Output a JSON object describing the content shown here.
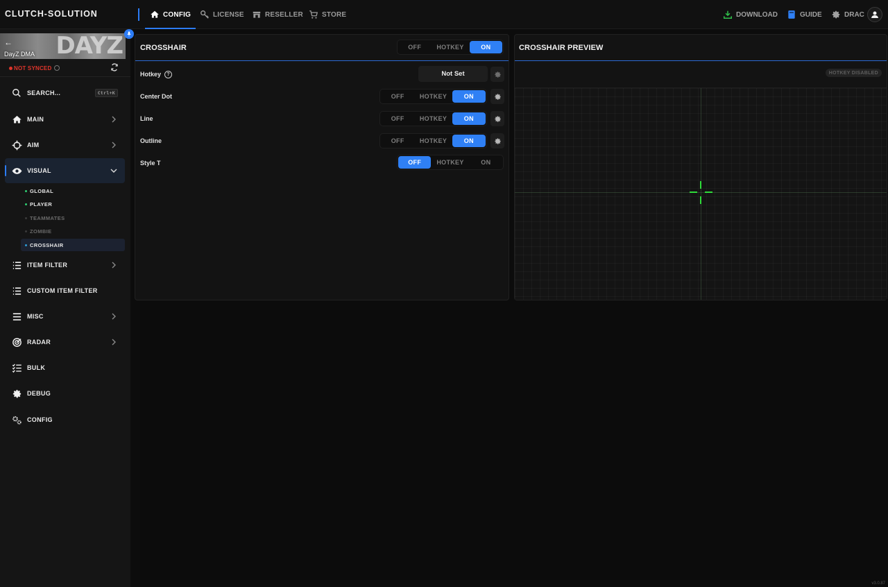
{
  "app": {
    "brand": "CLUTCH-SOLUTION",
    "accent_color": "#2f80f5",
    "version": "v3.0.87"
  },
  "top_nav": {
    "tabs": [
      {
        "label": "CONFIG",
        "icon": "home-icon",
        "active": true
      },
      {
        "label": "LICENSE",
        "icon": "key-icon",
        "active": false
      },
      {
        "label": "RESELLER",
        "icon": "store-icon",
        "active": false
      },
      {
        "label": "STORE",
        "icon": "cart-icon",
        "active": false
      }
    ],
    "right": {
      "download": "DOWNLOAD",
      "guide": "GUIDE",
      "user": "DRAC"
    }
  },
  "sidebar": {
    "game": {
      "name": "DayZ DMA",
      "logo_text": "DAYZ"
    },
    "sync_status": "NOT SYNCED",
    "search": {
      "label": "SEARCH...",
      "shortcut": "Ctrl+K"
    },
    "items": [
      {
        "label": "MAIN",
        "icon": "home-icon",
        "has_chevron": true
      },
      {
        "label": "AIM",
        "icon": "crosshair-icon",
        "has_chevron": true
      },
      {
        "label": "VISUAL",
        "icon": "eye-icon",
        "has_chevron": true,
        "expanded": true,
        "active": true
      },
      {
        "label": "ITEM FILTER",
        "icon": "list-icon",
        "has_chevron": true
      },
      {
        "label": "CUSTOM ITEM FILTER",
        "icon": "list-icon",
        "has_chevron": false
      },
      {
        "label": "MISC",
        "icon": "menu-icon",
        "has_chevron": true
      },
      {
        "label": "RADAR",
        "icon": "radar-icon",
        "has_chevron": true
      },
      {
        "label": "BULK",
        "icon": "checklist-icon",
        "has_chevron": false
      },
      {
        "label": "DEBUG",
        "icon": "gear-icon",
        "has_chevron": false
      },
      {
        "label": "CONFIG",
        "icon": "gears-icon",
        "has_chevron": false
      }
    ],
    "visual_sub": [
      {
        "label": "GLOBAL",
        "enabled": true,
        "active": false
      },
      {
        "label": "PLAYER",
        "enabled": true,
        "active": false
      },
      {
        "label": "TEAMMATES",
        "enabled": false,
        "active": false
      },
      {
        "label": "ZOMBIE",
        "enabled": false,
        "active": false
      },
      {
        "label": "CROSSHAIR",
        "enabled": true,
        "active": true
      }
    ]
  },
  "crosshair_panel": {
    "title": "CROSSHAIR",
    "options": [
      "OFF",
      "HOTKEY",
      "ON"
    ],
    "master_state": "ON",
    "hotkey": {
      "label": "Hotkey",
      "value": "Not Set"
    },
    "rows": [
      {
        "label": "Center Dot",
        "state": "ON",
        "has_gear": true
      },
      {
        "label": "Line",
        "state": "ON",
        "has_gear": true
      },
      {
        "label": "Outline",
        "state": "ON",
        "has_gear": true
      },
      {
        "label": "Style T",
        "state": "OFF",
        "has_gear": false
      }
    ]
  },
  "preview_panel": {
    "title": "CROSSHAIR PREVIEW",
    "hotkey_badge": "HOTKEY DISABLED",
    "crosshair_color": "#2fdc3a"
  }
}
